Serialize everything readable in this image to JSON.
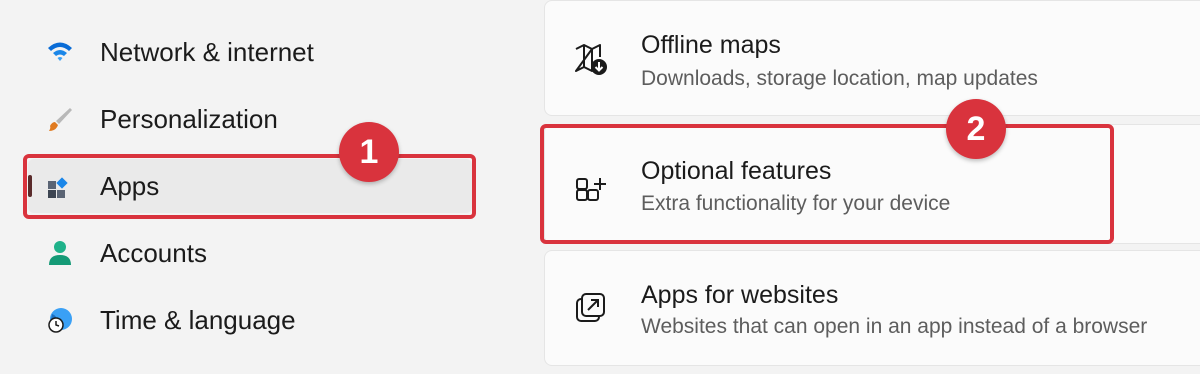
{
  "sidebar": {
    "items": [
      {
        "label": "Network & internet",
        "icon": "wifi-icon"
      },
      {
        "label": "Personalization",
        "icon": "paintbrush-icon"
      },
      {
        "label": "Apps",
        "icon": "apps-icon",
        "selected": true
      },
      {
        "label": "Accounts",
        "icon": "account-icon"
      },
      {
        "label": "Time & language",
        "icon": "globe-clock-icon"
      }
    ]
  },
  "cards": [
    {
      "title": "Offline maps",
      "subtitle": "Downloads, storage location, map updates",
      "icon": "offline-map-icon"
    },
    {
      "title": "Optional features",
      "subtitle": "Extra functionality for your device",
      "icon": "add-feature-icon"
    },
    {
      "title": "Apps for websites",
      "subtitle": "Websites that can open in an app instead of a browser",
      "icon": "open-in-app-icon"
    }
  ],
  "callouts": [
    {
      "label": "1"
    },
    {
      "label": "2"
    }
  ],
  "colors": {
    "highlight": "#d9333d",
    "page_background": "#f3f3f3",
    "card_background": "#fbfbfb",
    "accent_blue": "#0078d4"
  }
}
